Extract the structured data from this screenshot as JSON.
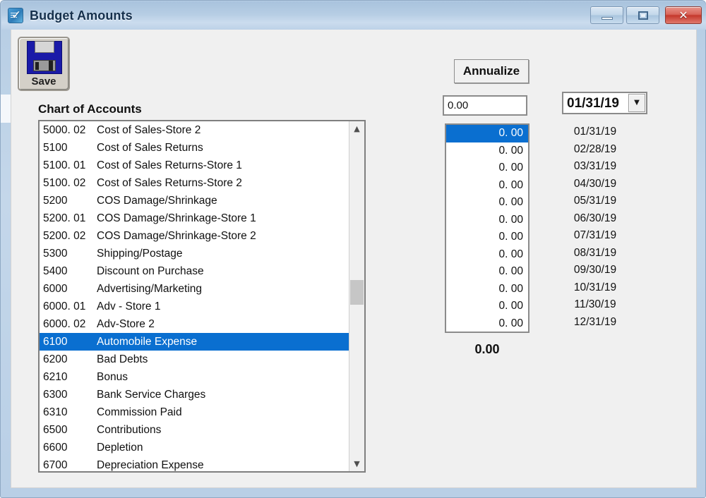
{
  "window": {
    "title": "Budget Amounts",
    "icon": "budget-document-icon",
    "controls": {
      "minimize": "minimize-icon",
      "maximize": "maximize-icon",
      "close": "close-icon"
    }
  },
  "toolbar": {
    "save_label": "Save",
    "save_icon": "floppy-disk-icon"
  },
  "chart_of_accounts": {
    "title": "Chart of Accounts",
    "selected_code": "6100",
    "rows": [
      {
        "code": "5000. 02",
        "desc": "Cost of Sales-Store 2",
        "selected": false
      },
      {
        "code": "5100",
        "desc": "Cost of Sales Returns",
        "selected": false
      },
      {
        "code": "5100. 01",
        "desc": "Cost of Sales Returns-Store 1",
        "selected": false
      },
      {
        "code": "5100. 02",
        "desc": "Cost of Sales Returns-Store 2",
        "selected": false
      },
      {
        "code": "5200",
        "desc": "COS Damage/Shrinkage",
        "selected": false
      },
      {
        "code": "5200. 01",
        "desc": "COS Damage/Shrinkage-Store 1",
        "selected": false
      },
      {
        "code": "5200. 02",
        "desc": "COS Damage/Shrinkage-Store 2",
        "selected": false
      },
      {
        "code": "5300",
        "desc": "Shipping/Postage",
        "selected": false
      },
      {
        "code": "5400",
        "desc": "Discount on Purchase",
        "selected": false
      },
      {
        "code": "6000",
        "desc": "Advertising/Marketing",
        "selected": false
      },
      {
        "code": "6000. 01",
        "desc": "Adv - Store 1",
        "selected": false
      },
      {
        "code": "6000. 02",
        "desc": "Adv-Store 2",
        "selected": false
      },
      {
        "code": "6100",
        "desc": "Automobile Expense",
        "selected": true
      },
      {
        "code": "6200",
        "desc": "Bad Debts",
        "selected": false
      },
      {
        "code": "6210",
        "desc": "Bonus",
        "selected": false
      },
      {
        "code": "6300",
        "desc": "Bank Service Charges",
        "selected": false
      },
      {
        "code": "6310",
        "desc": "Commission Paid",
        "selected": false
      },
      {
        "code": "6500",
        "desc": "Contributions",
        "selected": false
      },
      {
        "code": "6600",
        "desc": "Depletion",
        "selected": false
      },
      {
        "code": "6700",
        "desc": "Depreciation Expense",
        "selected": false
      }
    ],
    "scrollbar": {
      "up_arrow": "chevron-up-icon",
      "down_arrow": "chevron-down-icon"
    }
  },
  "budget_panel": {
    "annualize_label": "Annualize",
    "amount_input_value": "0.00",
    "period_select_value": "01/31/19",
    "period_select_arrow": "chevron-down-icon",
    "total_value": "0.00",
    "periods": [
      {
        "date": "01/31/19",
        "amount": "0. 00",
        "selected": true
      },
      {
        "date": "02/28/19",
        "amount": "0. 00",
        "selected": false
      },
      {
        "date": "03/31/19",
        "amount": "0. 00",
        "selected": false
      },
      {
        "date": "04/30/19",
        "amount": "0. 00",
        "selected": false
      },
      {
        "date": "05/31/19",
        "amount": "0. 00",
        "selected": false
      },
      {
        "date": "06/30/19",
        "amount": "0. 00",
        "selected": false
      },
      {
        "date": "07/31/19",
        "amount": "0. 00",
        "selected": false
      },
      {
        "date": "08/31/19",
        "amount": "0. 00",
        "selected": false
      },
      {
        "date": "09/30/19",
        "amount": "0. 00",
        "selected": false
      },
      {
        "date": "10/31/19",
        "amount": "0. 00",
        "selected": false
      },
      {
        "date": "11/30/19",
        "amount": "0. 00",
        "selected": false
      },
      {
        "date": "12/31/19",
        "amount": "0. 00",
        "selected": false
      }
    ]
  },
  "colors": {
    "selection_blue": "#0a6fd0",
    "title_gradient_top": "#a9c3dd",
    "title_gradient_bottom": "#bcd1e7",
    "client_background": "#f0f0f0",
    "close_button_red": "#c5382c"
  }
}
